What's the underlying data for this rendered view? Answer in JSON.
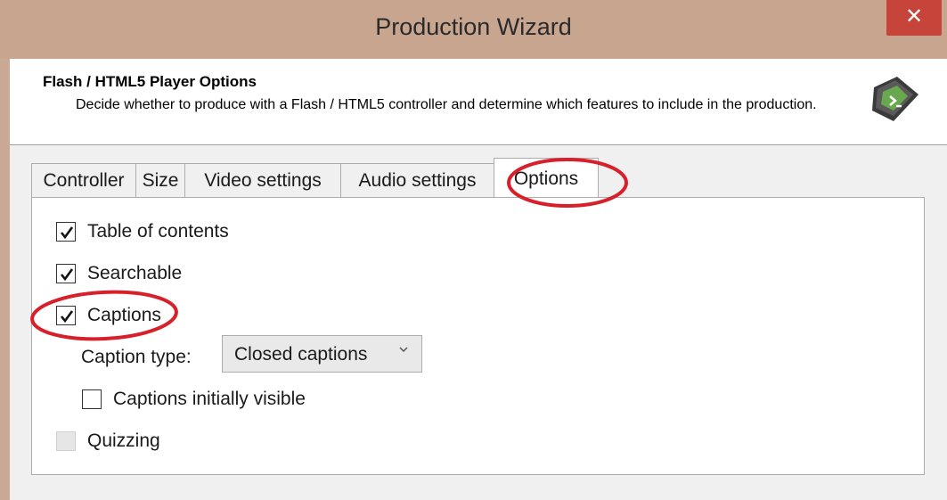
{
  "window": {
    "title": "Production Wizard",
    "close_glyph": "✕"
  },
  "header": {
    "title": "Flash / HTML5 Player Options",
    "description": "Decide whether to produce with a Flash / HTML5 controller and determine which features to include in the production.",
    "icon": "wizard-film-icon"
  },
  "tabs": [
    {
      "label": "Controller",
      "active": false
    },
    {
      "label": "Size",
      "active": false
    },
    {
      "label": "Video settings",
      "active": false
    },
    {
      "label": "Audio settings",
      "active": false
    },
    {
      "label": "Options",
      "active": true
    }
  ],
  "options": {
    "table_of_contents": {
      "label": "Table of contents",
      "checked": true
    },
    "searchable": {
      "label": "Searchable",
      "checked": true
    },
    "captions": {
      "label": "Captions",
      "checked": true
    },
    "caption_type": {
      "label": "Caption type:",
      "selected": "Closed captions"
    },
    "captions_initially_visible": {
      "label": "Captions initially visible",
      "checked": false
    },
    "quizzing": {
      "label": "Quizzing",
      "checked": false,
      "disabled": true
    }
  },
  "colors": {
    "titlebar": "#c8a58f",
    "close_button": "#c7443a",
    "annotation_red": "#d8202a"
  }
}
